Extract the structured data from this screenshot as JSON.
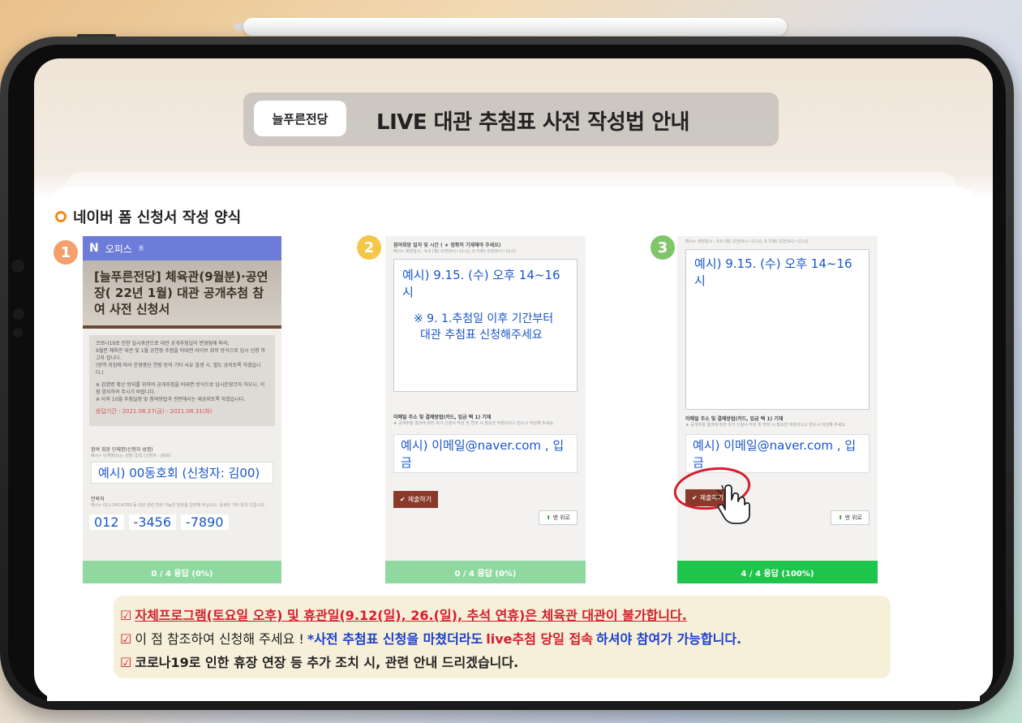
{
  "header": {
    "brand": "늘푸른전당",
    "title": "LIVE 대관 추첨표 사전 작성법 안내"
  },
  "section": {
    "title": "네이버 폼 신청서 작성 양식"
  },
  "steps": [
    {
      "number": "1"
    },
    {
      "number": "2"
    },
    {
      "number": "3"
    }
  ],
  "panel1": {
    "app_logo": "N",
    "app_name": "오피스",
    "app_suffix": "폼",
    "form_title": "[늘푸른전당] 체육관(9월분)·공연장( 22년 1월) 대관 공개추첨 참여 사전 신청서",
    "notice_lines": [
      "코로나19로 인한 일시휴관으로 대관 공개추첨일이 변경됨에 따라,",
      "9월분 체육관 대관 및 1월 공연장 추첨을 비대면 라이브 회의 방식으로 임시 신청 하고자 합니다.",
      "(방역 지침에 따라 운영중단 연장 등의 기타 사유 발생 시, 별도 공지토록 하겠습니다.)",
      "※ 감염병 확산 방지를 위하여 공개추첨을 비대면 방식으로 임시운영코자 하오니, 이점 양지하여 주시기 바랍니다.",
      "※ 이후 10월 추첨일정 및 참여방법과 관련해서는 재공지토록 하겠습니다."
    ],
    "notice_period": "응답기간 : 2021.08.27(금) - 2021.08.31(화)",
    "group_label": "참여 희망 단체명(신청자 성명)",
    "group_hint": "예시> 단체명(또는 성명) 입력 (신청자 : 김00)",
    "group_example": "예시) 00동호회 (신청자: 김00)",
    "phone_label": "연락처",
    "phone_hint": "예시> 012-345-6789 등 대관 관련 연락 가능한 번호를 입력해 주십시오. 상세한 기타 문의 드립니다.",
    "phone_parts": [
      "012",
      "-3456",
      "-7890"
    ],
    "progress": "0 / 4 응답 (0%)",
    "progress_value": 0
  },
  "panel2": {
    "top_label": "참여희망 일자 및 시간 ( ★ 정확히 기재해야 주세요)",
    "top_hint": "예시> 희망일시 : 9.6 (월) 오전(9시~11시), 9.7(화) 오전(9시~11시)",
    "example_time": "예시) 9.15. (수) 오후 14~16시",
    "note_line1": "※ 9. 1.추첨일 이후 기간부터",
    "note_line2": "대관 추첨표 신청해주세요",
    "email_label": "이메일 주소 및 결제방법(카드, 입금 택 1) 기재",
    "email_hint": "★ 공개추첨 결과에 따라 위가 신청서 작성 및 연락 시 필요한 부분이오니 반드시 작성해 주세요.",
    "email_example": "예시) 이메일@naver.com , 입금",
    "submit": "제출하기",
    "top_button": "맨 위로",
    "progress": "0 / 4 응답 (0%)",
    "progress_value": 0
  },
  "panel3": {
    "top_hint": "예시> 희망일시 : 9.6 (월) 오전(9시~11시), 9.7(화) 오전(9시~11시)",
    "example_time": "예시) 9.15. (수) 오후 14~16시",
    "email_label": "이메일 주소 및 결제방법(카드, 입금 택 1) 기재",
    "email_hint": "★ 공개추첨 결과에 따라 위가 신청서 작성 및 연락 시 필요한 부분이오니 반드시 작성해 주세요.",
    "email_example": "예시) 이메일@naver.com , 입금",
    "submit": "제출하기",
    "top_button": "맨 위로",
    "progress": "4 / 4 응답 (100%)",
    "progress_value": 100
  },
  "notice": {
    "line1": "자체프로그램(토요일 오후) 및 휴관일(9.12(일), 26.(일), 추석 연휴)은 체육관 대관이 불가합니다.",
    "line2_a": "이 점 참조하여 신청해 주세요 ! ",
    "line2_b": "*사전 추첨표 신청을 마쳤더라도 ",
    "line2_c": "live추첨 당일 접속",
    "line2_d": "하셔야 참여가 가능합니다.",
    "line3": "코로나19로 인한 휴장 연장 등 추가 조치 시, 관련 안내 드리겠습니다."
  },
  "colors": {
    "accent_orange": "#f08a1b",
    "naver_bar": "#6c7cd8",
    "progress_full": "#1fc44a",
    "notice_red": "#d41e2c",
    "notice_blue": "#1a3ec9"
  }
}
